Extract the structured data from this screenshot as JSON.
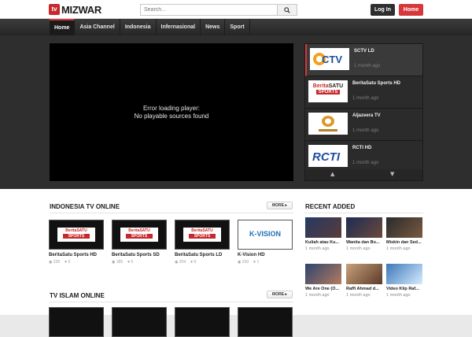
{
  "header": {
    "logo_badge": "tv",
    "logo_text": "MIZWAR",
    "search_placeholder": "Search...",
    "login_label": "Log In",
    "home_label": "Home"
  },
  "nav": {
    "items": [
      "Home",
      "Asia Channel",
      "Indonesia",
      "Infernasional",
      "News",
      "Sport"
    ],
    "active": "Home"
  },
  "player": {
    "error_line1": "Error loading player:",
    "error_line2": "No playable sources found"
  },
  "playlist": {
    "items": [
      {
        "title": "SCTV LD",
        "time": "1 month ago",
        "logo": "SCTV",
        "active": true
      },
      {
        "title": "BeritaSatu Sports HD",
        "time": "1 month ago",
        "logo": "BeritaSatu Sports"
      },
      {
        "title": "Aljazeera TV",
        "time": "1 month ago",
        "logo": "Al Jazeera"
      },
      {
        "title": "RCTI HD",
        "time": "1 month ago",
        "logo": "RCTI"
      }
    ]
  },
  "indonesia": {
    "title": "INDONESIA TV ONLINE",
    "more_label": "MORE ▸",
    "cards": [
      {
        "title": "BeritaSatu Sports HD",
        "views": "239",
        "likes": "0",
        "logo_top": "BeritaSATU",
        "logo_bottom": "SPORTS"
      },
      {
        "title": "BeritaSatu Sports SD",
        "views": "185",
        "likes": "0",
        "logo_top": "BeritaSATU",
        "logo_bottom": "SPORTS"
      },
      {
        "title": "BeritaSatu Sports LD",
        "views": "204",
        "likes": "0",
        "logo_top": "BeritaSATU",
        "logo_bottom": "SPORTS"
      },
      {
        "title": "K-Vision HD",
        "views": "230",
        "likes": "1",
        "logo_text": "K-VISION"
      }
    ]
  },
  "islam": {
    "title": "TV ISLAM ONLINE",
    "more_label": "MORE ▸"
  },
  "recent": {
    "title": "RECENT ADDED",
    "items": [
      {
        "title": "Kuliah atau Ku...",
        "time": "1 month ago"
      },
      {
        "title": "Wanita dan Bo...",
        "time": "1 month ago"
      },
      {
        "title": "Miskin dan Sed...",
        "time": "1 month ago"
      },
      {
        "title": "We Are One (O...",
        "time": "1 month ago"
      },
      {
        "title": "Raffi Ahmad d...",
        "time": "1 month ago"
      },
      {
        "title": "Video Klip Raf...",
        "time": "1 month ago"
      }
    ]
  },
  "colors": {
    "accent": "#d7373b",
    "nav_bg": "#2f2f2f",
    "stage_bg": "#2e2e2e"
  }
}
